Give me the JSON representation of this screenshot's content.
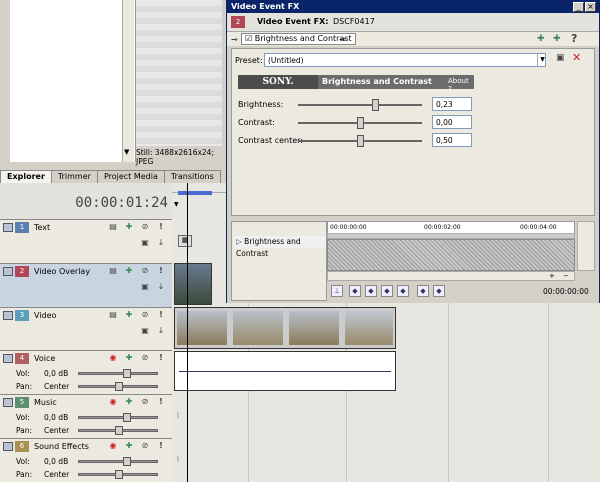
{
  "explorer": {
    "info_text": "Still: 3488x2616x24; JPEG",
    "tabs": [
      "Explorer",
      "Trimmer",
      "Project Media",
      "Transitions"
    ]
  },
  "timecode": "00:00:01:24",
  "tracks": [
    {
      "num": "1",
      "name": "Text"
    },
    {
      "num": "2",
      "name": "Video Overlay"
    },
    {
      "num": "3",
      "name": "Video"
    },
    {
      "num": "4",
      "name": "Voice",
      "vol_label": "Vol:",
      "vol_value": "0,0 dB",
      "pan_label": "Pan:",
      "pan_value": "Center"
    },
    {
      "num": "5",
      "name": "Music",
      "vol_label": "Vol:",
      "vol_value": "0,0 dB",
      "pan_label": "Pan:",
      "pan_value": "Center"
    },
    {
      "num": "6",
      "name": "Sound Effects",
      "vol_label": "Vol:",
      "vol_value": "0,0 dB",
      "pan_label": "Pan:",
      "pan_value": "Center"
    }
  ],
  "fx": {
    "window_title": "Video Event FX",
    "event_num": "2",
    "event_label": "Video Event FX:",
    "event_name": "DSCF0417",
    "chain_item": "Brightness and Contrast",
    "preset_label": "Preset:",
    "preset_value": "(Untitled)",
    "brand": "SONY.",
    "plugin_name": "Brightness and Contrast",
    "about": "About",
    "params": [
      {
        "label": "Brightness:",
        "value": "0,23",
        "level": 0.62
      },
      {
        "label": "Contrast:",
        "value": "0,00",
        "level": 0.5
      },
      {
        "label": "Contrast center:",
        "value": "0,50",
        "level": 0.5
      }
    ],
    "kf_track": "Brightness and Contrast",
    "kf_ticks": [
      "00:00:00:00",
      "00:00:02:00",
      "00:00:04:00"
    ],
    "kf_time": "00:00:00:00"
  },
  "colors": {
    "title_bar": "#0a246a",
    "track1": "#5b7fb0",
    "track2": "#b04858",
    "track3": "#5aa0b8",
    "track4": "#b06060",
    "track5": "#5a9070",
    "track6": "#a89050"
  }
}
